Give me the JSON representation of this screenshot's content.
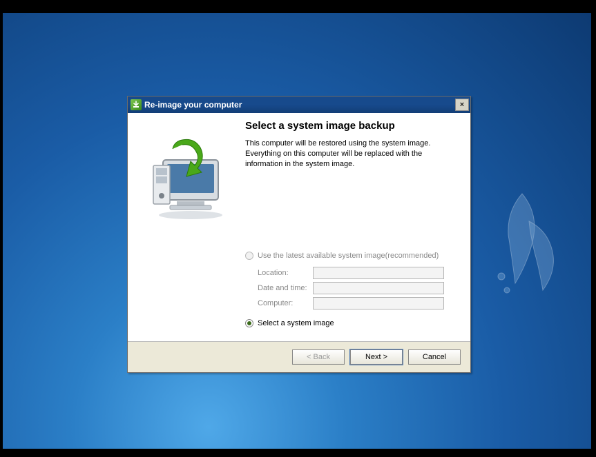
{
  "window": {
    "title": "Re-image your computer",
    "close_label": "×"
  },
  "page": {
    "heading": "Select a system image backup",
    "description": "This computer will be restored using the system image. Everything on this computer will be replaced with the information in the system image."
  },
  "options": {
    "latest": {
      "label": "Use the latest available system image(recommended)",
      "enabled": false,
      "selected": false
    },
    "fields": {
      "location": {
        "label": "Location:",
        "value": ""
      },
      "date_time": {
        "label": "Date and time:",
        "value": ""
      },
      "computer": {
        "label": "Computer:",
        "value": ""
      }
    },
    "select_manual": {
      "label": "Select a system image",
      "enabled": true,
      "selected": true
    }
  },
  "buttons": {
    "back": "< Back",
    "next": "Next >",
    "cancel": "Cancel"
  }
}
